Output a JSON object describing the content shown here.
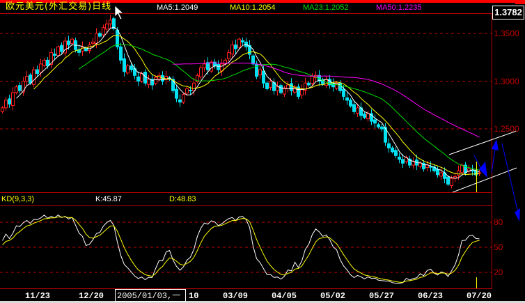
{
  "header": {
    "title": "欧元美元(外汇交易)日线",
    "ma5": "MA5:1.2049",
    "ma10": "MA10:1.2054",
    "ma23": "MA23:1.2052",
    "ma50": "MA50:1.2235",
    "current_price": "1.3782"
  },
  "kd_header": {
    "label": "KD(9,3,3)",
    "k": "K:45.87",
    "d": "D:48.83"
  },
  "cursor_date": "2005/01/03,一",
  "colors": {
    "up": "#ff2020",
    "down": "#00e0f0",
    "ma5": "#ffffff",
    "ma10": "#ffff00",
    "ma23": "#00e000",
    "ma50": "#ff00ff",
    "grid": "#c00000",
    "k": "#ffffff",
    "d": "#ffff00"
  },
  "chart_data": [
    {
      "type": "candlestick",
      "title": "欧元美元(外汇交易)日线",
      "ylim": [
        1.184,
        1.37
      ],
      "y_ticks": [
        "1.3500",
        "1.3000",
        "1.2500"
      ],
      "y_tick_values": [
        1.35,
        1.3,
        1.25
      ],
      "x_ticks": [
        "11/23",
        "12/20",
        "10",
        "03/09",
        "04/05",
        "05/02",
        "05/27",
        "06/23",
        "07/20"
      ],
      "moving_averages": [
        5,
        10,
        23,
        50
      ],
      "close": [
        1.272,
        1.28,
        1.276,
        1.288,
        1.294,
        1.29,
        1.3,
        1.305,
        1.298,
        1.312,
        1.308,
        1.318,
        1.322,
        1.316,
        1.33,
        1.327,
        1.336,
        1.331,
        1.342,
        1.338,
        1.344,
        1.333,
        1.33,
        1.336,
        1.332,
        1.338,
        1.341,
        1.35,
        1.347,
        1.356,
        1.36,
        1.364,
        1.355,
        1.336,
        1.322,
        1.31,
        1.316,
        1.312,
        1.306,
        1.3,
        1.308,
        1.298,
        1.302,
        1.296,
        1.304,
        1.306,
        1.3,
        1.305,
        1.302,
        1.29,
        1.282,
        1.278,
        1.286,
        1.292,
        1.29,
        1.298,
        1.306,
        1.314,
        1.318,
        1.312,
        1.32,
        1.316,
        1.312,
        1.318,
        1.322,
        1.33,
        1.338,
        1.334,
        1.344,
        1.341,
        1.336,
        1.328,
        1.318,
        1.305,
        1.312,
        1.298,
        1.292,
        1.3,
        1.29,
        1.294,
        1.288,
        1.292,
        1.296,
        1.29,
        1.294,
        1.284,
        1.292,
        1.298,
        1.296,
        1.305,
        1.306,
        1.3,
        1.297,
        1.302,
        1.296,
        1.294,
        1.298,
        1.29,
        1.284,
        1.28,
        1.274,
        1.268,
        1.272,
        1.264,
        1.262,
        1.266,
        1.258,
        1.256,
        1.252,
        1.25,
        1.236,
        1.23,
        1.226,
        1.222,
        1.218,
        1.214,
        1.22,
        1.212,
        1.216,
        1.212,
        1.214,
        1.208,
        1.212,
        1.21,
        1.206,
        1.202,
        1.204,
        1.198,
        1.192,
        1.198,
        1.2,
        1.206,
        1.212,
        1.204,
        1.208,
        1.206,
        1.202,
        1.204
      ]
    },
    {
      "type": "line",
      "title": "KD(9,3,3)",
      "ylim": [
        0,
        100
      ],
      "y_ticks": [
        "80",
        "50",
        "20"
      ],
      "y_tick_values": [
        80,
        50,
        20
      ],
      "series": [
        {
          "name": "K",
          "last": 45.87
        },
        {
          "name": "D",
          "last": 48.83
        }
      ]
    }
  ]
}
